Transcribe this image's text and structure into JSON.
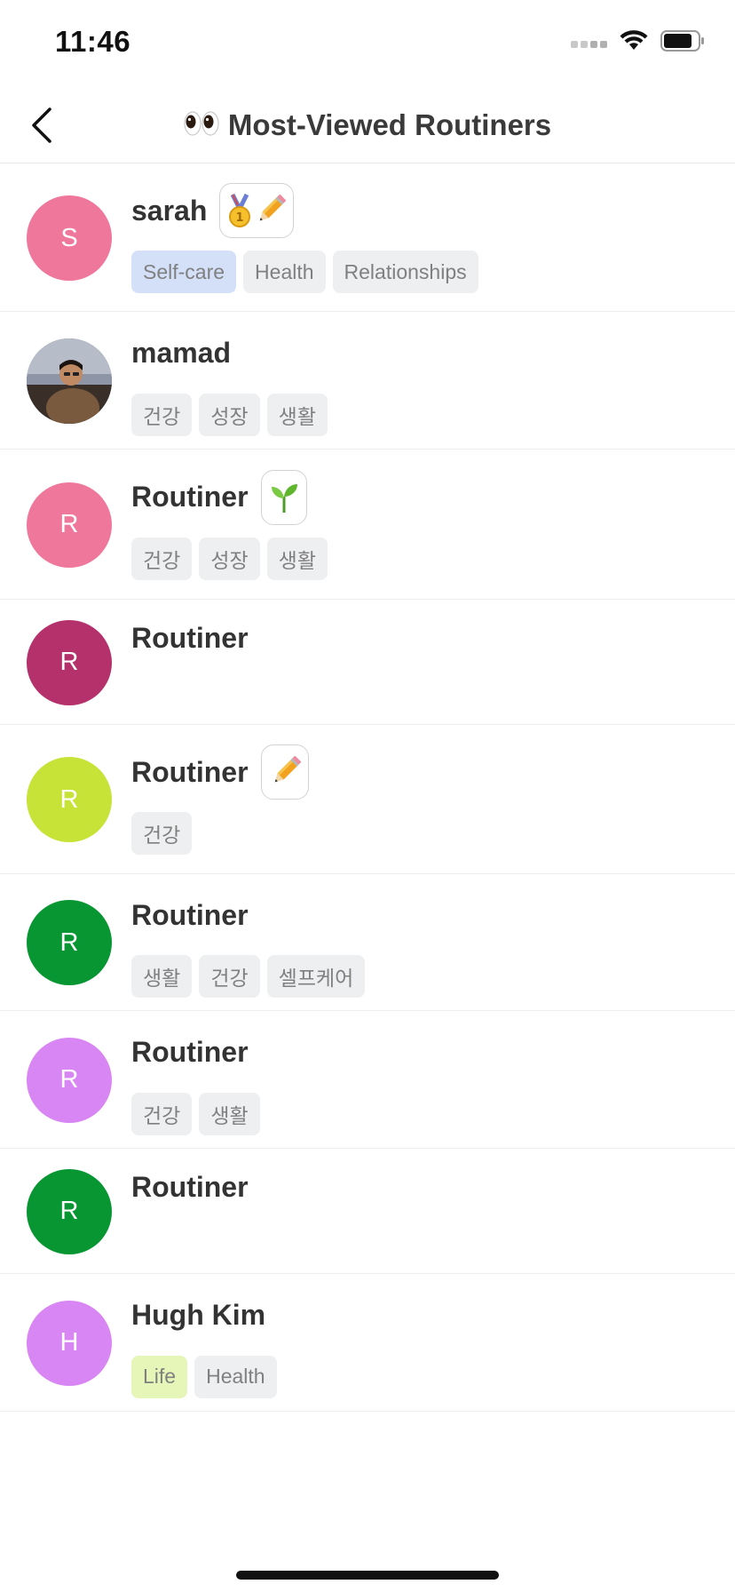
{
  "status_bar": {
    "time": "11:46"
  },
  "header": {
    "title": "Most-Viewed Routiners",
    "title_icon": "eyes-emoji"
  },
  "colors": {
    "tag_default_bg": "#eeeff1",
    "tag_highlight_blue": "#d3e0f8",
    "tag_highlight_lime": "#e6f6b8"
  },
  "routiners": [
    {
      "initial": "S",
      "name": "sarah",
      "avatar_color": "#f0779c",
      "badges": [
        "medal",
        "pencil"
      ],
      "tags": [
        {
          "label": "Self-care",
          "highlight": "blue"
        },
        {
          "label": "Health"
        },
        {
          "label": "Relationships"
        }
      ]
    },
    {
      "initial": "",
      "name": "mamad",
      "avatar_color": "#6a6e7a",
      "avatar_type": "photo",
      "badges": [],
      "tags": [
        {
          "label": "건강"
        },
        {
          "label": "성장"
        },
        {
          "label": "생활"
        }
      ]
    },
    {
      "initial": "R",
      "name": "Routiner",
      "avatar_color": "#f0779c",
      "badges": [
        "seedling"
      ],
      "tags": [
        {
          "label": "건강"
        },
        {
          "label": "성장"
        },
        {
          "label": "생활"
        }
      ]
    },
    {
      "initial": "R",
      "name": "Routiner",
      "avatar_color": "#b5316c",
      "badges": [],
      "tags": []
    },
    {
      "initial": "R",
      "name": "Routiner",
      "avatar_color": "#c8e338",
      "badges": [
        "pencil"
      ],
      "tags": [
        {
          "label": "건강"
        }
      ]
    },
    {
      "initial": "R",
      "name": "Routiner",
      "avatar_color": "#089633",
      "badges": [],
      "tags": [
        {
          "label": "생활"
        },
        {
          "label": "건강"
        },
        {
          "label": "셀프케어"
        }
      ]
    },
    {
      "initial": "R",
      "name": "Routiner",
      "avatar_color": "#d986f5",
      "badges": [],
      "tags": [
        {
          "label": "건강"
        },
        {
          "label": "생활"
        }
      ]
    },
    {
      "initial": "R",
      "name": "Routiner",
      "avatar_color": "#089633",
      "badges": [],
      "tags": []
    },
    {
      "initial": "H",
      "name": "Hugh Kim",
      "avatar_color": "#d986f5",
      "badges": [],
      "tags": [
        {
          "label": "Life",
          "highlight": "lime"
        },
        {
          "label": "Health"
        }
      ]
    }
  ]
}
